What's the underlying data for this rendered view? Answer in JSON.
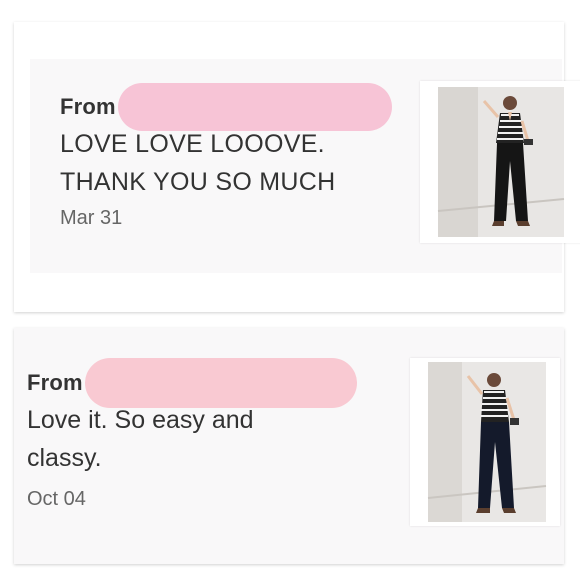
{
  "reviews": [
    {
      "from_label": "From",
      "message": "LOVE LOVE LOOOVE. THANK YOU SO MUCH",
      "date": "Mar 31",
      "redaction_color": "#f7c4d6"
    },
    {
      "from_label": "From",
      "message": "Love it. So easy and classy.",
      "date": "Oct 04",
      "redaction_color": "#f9c9d2"
    }
  ],
  "thumbnail_icon": "product-photo-jumpsuit",
  "colors": {
    "text": "#333333",
    "date": "#666666",
    "review_bg": "#f9f8f9"
  }
}
